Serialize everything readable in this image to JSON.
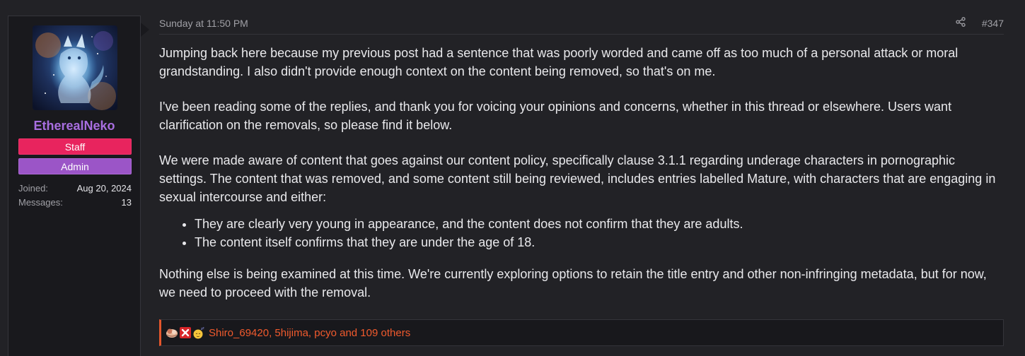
{
  "user": {
    "name": "EtherealNeko",
    "banners": [
      "Staff",
      "Admin"
    ],
    "stats": [
      {
        "label": "Joined:",
        "value": "Aug 20, 2024"
      },
      {
        "label": "Messages:",
        "value": "13"
      }
    ]
  },
  "post": {
    "date": "Sunday at 11:50 PM",
    "number": "#347",
    "paragraphs": [
      "Jumping back here because my previous post had a sentence that was poorly worded and came off as too much of a personal attack or moral grandstanding. I also didn't provide enough context on the content being removed, so that's on me.",
      "I've been reading some of the replies, and thank you for voicing your opinions and concerns, whether in this thread or elsewhere. Users want clarification on the removals, so please find it below.",
      "We were made aware of content that goes against our content policy, specifically clause 3.1.1 regarding underage characters in pornographic settings. The content that was removed, and some content still being reviewed, includes entries labelled Mature, with characters that are engaging in sexual intercourse and either:",
      "Nothing else is being examined at this time. We're currently exploring options to retain the title entry and other non-infringing metadata, but for now, we need to proceed with the removal."
    ],
    "bullets": [
      "They are clearly very young in appearance, and the content does not confirm that they are adults.",
      "The content itself confirms that they are under the age of 18."
    ]
  },
  "reactions": {
    "icons": [
      "hug-reaction-icon",
      "x-reaction-icon",
      "sleepy-reaction-icon"
    ],
    "list_text": "Shiro_69420, 5hijima, pcyo and 109 others"
  },
  "colors": {
    "username": "#a86ee0",
    "staff_banner": "#e8245e",
    "admin_banner": "#9b55c7",
    "reaction_accent": "#f05a2d"
  }
}
